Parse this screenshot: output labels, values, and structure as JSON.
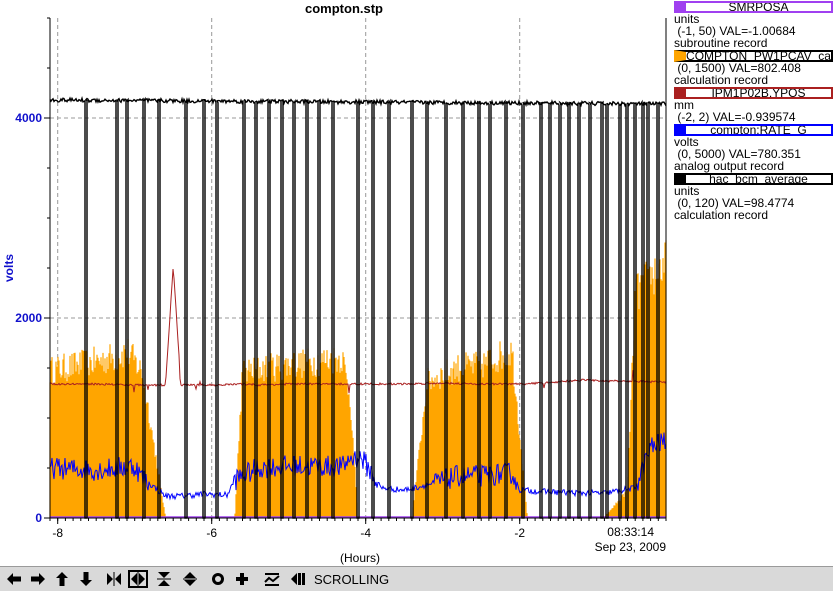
{
  "chart_data": {
    "type": "line",
    "title": "compton.stp",
    "xlabel": "(Hours)",
    "ylabel": "volts",
    "xlim": [
      -8.1,
      -0.1
    ],
    "ylim": [
      0,
      5000
    ],
    "yticks": [
      0,
      2000,
      4000
    ],
    "ytick_labels": [
      "0",
      "2000",
      "4000"
    ],
    "xticks": [
      -8,
      -6,
      -4,
      -2
    ],
    "xtick_labels": [
      "-8",
      "-6",
      "-4",
      "-2"
    ],
    "grid": true,
    "end_time": "08:33:14",
    "end_date": "Sep 23, 2009",
    "legend_position": "right",
    "series": [
      {
        "name": "SMRPOSA",
        "color": "#a040f0",
        "units": "units",
        "range": "(-1, 50)",
        "val": "VAL=-1.00684",
        "record": "subroutine record",
        "x": [
          -8.1,
          -0.1
        ],
        "y": [
          0,
          0
        ]
      },
      {
        "name": "COMPTON_PW1PCAV_ca",
        "color": "#ffa500",
        "units": "",
        "range": "(0, 1500)",
        "val": "VAL=802.408",
        "record": "calculation record",
        "envelope": {
          "x": [
            -8.1,
            -7.6,
            -7.2,
            -7.1,
            -6.9,
            -6.6,
            -6.3,
            -5.8,
            -5.7,
            -5.6,
            -5.3,
            -4.8,
            -4.3,
            -4.2,
            -4.1,
            -3.9,
            -3.6,
            -3.4,
            -3.2,
            -2.8,
            -2.5,
            -2.3,
            -2.1,
            -1.9,
            -1.6,
            -1.3,
            -0.9,
            -0.6,
            -0.5,
            -0.3,
            -0.1
          ],
          "hi": [
            1620,
            1700,
            1780,
            1840,
            1600,
            10,
            10,
            10,
            10,
            1600,
            1650,
            1700,
            1760,
            1300,
            10,
            10,
            10,
            10,
            1500,
            1650,
            1680,
            1760,
            1840,
            10,
            10,
            10,
            10,
            300,
            2450,
            2650,
            2800
          ]
        }
      },
      {
        "name": "IPM1P02B.YPOS",
        "color": "#aa2020",
        "units": "mm",
        "range": "(-2, 2)",
        "val": "VAL=-0.939574",
        "record": "",
        "x": [
          -8.1,
          -7.5,
          -7.0,
          -6.6,
          -6.5,
          -6.4,
          -6.0,
          -5.5,
          -5.4,
          -5.0,
          -4.6,
          -4.0,
          -3.5,
          -3.0,
          -2.5,
          -2.0,
          -1.7,
          -1.2,
          -0.8,
          -0.1
        ],
        "y": [
          1340,
          1340,
          1330,
          1330,
          2520,
          1330,
          1330,
          1340,
          1330,
          1340,
          1340,
          1340,
          1340,
          1350,
          1340,
          1340,
          1350,
          1380,
          1370,
          1360
        ]
      },
      {
        "name": "compton:RATE_G",
        "color": "#0000ff",
        "units": "volts",
        "range": "(0, 5000)",
        "val": "VAL=780.351",
        "record": "analog output record",
        "x": [
          -8.1,
          -7.5,
          -7.0,
          -6.9,
          -6.6,
          -6.4,
          -6.1,
          -5.8,
          -5.7,
          -5.4,
          -5.0,
          -4.6,
          -4.3,
          -4.2,
          -4.05,
          -3.8,
          -3.5,
          -3.2,
          -2.8,
          -2.5,
          -2.1,
          -2.0,
          -1.6,
          -1.2,
          -0.9,
          -0.5,
          -0.3,
          -0.1
        ],
        "y": [
          500,
          480,
          520,
          400,
          220,
          220,
          240,
          230,
          380,
          500,
          520,
          520,
          510,
          600,
          600,
          300,
          280,
          330,
          420,
          420,
          450,
          280,
          260,
          250,
          250,
          300,
          700,
          780
        ]
      },
      {
        "name": "hac_bcm_average",
        "color": "#000000",
        "units": "units",
        "range": "(0, 120)",
        "val": "VAL=98.4774",
        "record": "calculation record",
        "x": [
          -8.1,
          -0.1
        ],
        "y": [
          4180,
          4140
        ],
        "drops": [
          -7.65,
          -7.25,
          -7.12,
          -6.9,
          -6.7,
          -6.35,
          -6.12,
          -5.95,
          -5.6,
          -5.45,
          -5.27,
          -5.1,
          -4.95,
          -4.78,
          -4.62,
          -4.45,
          -4.12,
          -3.92,
          -3.72,
          -3.42,
          -3.22,
          -2.98,
          -2.75,
          -2.55,
          -2.4,
          -2.2,
          -1.98,
          -1.74,
          -1.63,
          -1.5,
          -1.38,
          -1.25,
          -1.1,
          -0.95,
          -0.88,
          -0.72,
          -0.62,
          -0.52,
          -0.42,
          -0.35,
          -0.22
        ]
      }
    ]
  },
  "toolbar": {
    "buttons": [
      "arrow-left-icon",
      "arrow-right-icon",
      "arrow-up-icon",
      "arrow-down-icon",
      "zoom-in-horizontal-icon",
      "zoom-out-horizontal-icon",
      "zoom-in-vertical-icon",
      "zoom-out-vertical-icon",
      "auto-scale-icon",
      "add-plus-icon",
      "time-mode-icon",
      "back-arrow-icon"
    ],
    "status": "SCROLLING"
  }
}
